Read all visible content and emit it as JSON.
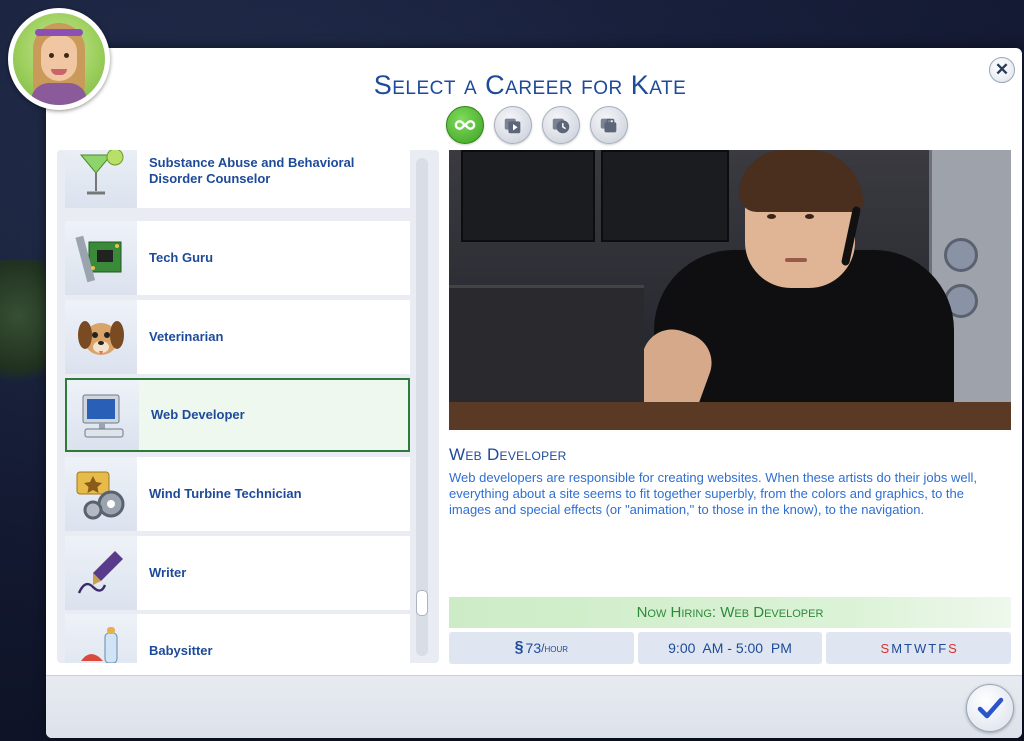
{
  "dialog": {
    "title": "Select a Career for Kate",
    "close_label": "✕",
    "confirm_label": "Confirm"
  },
  "filters": [
    {
      "icon": "infinity-icon",
      "active": true
    },
    {
      "icon": "expansion-pack-icon",
      "active": false
    },
    {
      "icon": "game-pack-clock-icon",
      "active": false
    },
    {
      "icon": "stuff-pack-icon",
      "active": false
    }
  ],
  "careers": [
    {
      "label": "Substance Abuse and Behavioral Disorder Counselor",
      "icon": "cocktail-icon",
      "selected": false
    },
    {
      "label": "Tech Guru",
      "icon": "circuit-board-icon",
      "selected": false
    },
    {
      "label": "Veterinarian",
      "icon": "dog-icon",
      "selected": false
    },
    {
      "label": "Web Developer",
      "icon": "computer-icon",
      "selected": true
    },
    {
      "label": "Wind Turbine Technician",
      "icon": "gears-icon",
      "selected": false
    },
    {
      "label": "Writer",
      "icon": "fountain-pen-icon",
      "selected": false
    },
    {
      "label": "Babysitter",
      "icon": "baby-bottle-icon",
      "selected": false,
      "pack_icon": "stuff-pack-icon"
    }
  ],
  "detail": {
    "title": "Web Developer",
    "description": "Web developers are responsible for creating websites. When these artists do their jobs well, everything about a site seems to fit together superbly, from the colors and graphics, to the images and special effects (or \"animation,\" to those in the know), to the navigation.",
    "hiring": "Now Hiring: Web Developer",
    "pay_symbol": "§",
    "pay_amount": "73",
    "pay_unit": "/hour",
    "hours": "9:00  AM - 5:00  PM",
    "days": [
      {
        "letter": "S",
        "work": false
      },
      {
        "letter": "M",
        "work": true
      },
      {
        "letter": "T",
        "work": true
      },
      {
        "letter": "W",
        "work": true
      },
      {
        "letter": "T",
        "work": true
      },
      {
        "letter": "F",
        "work": true
      },
      {
        "letter": "S",
        "work": false
      }
    ]
  },
  "colors": {
    "title_blue": "#1d4a9a",
    "desc_blue": "#2f6fd1",
    "hiring_green": "#2e8a3a",
    "selected_border": "#2e7a3a",
    "off_day_red": "#d9322e"
  }
}
